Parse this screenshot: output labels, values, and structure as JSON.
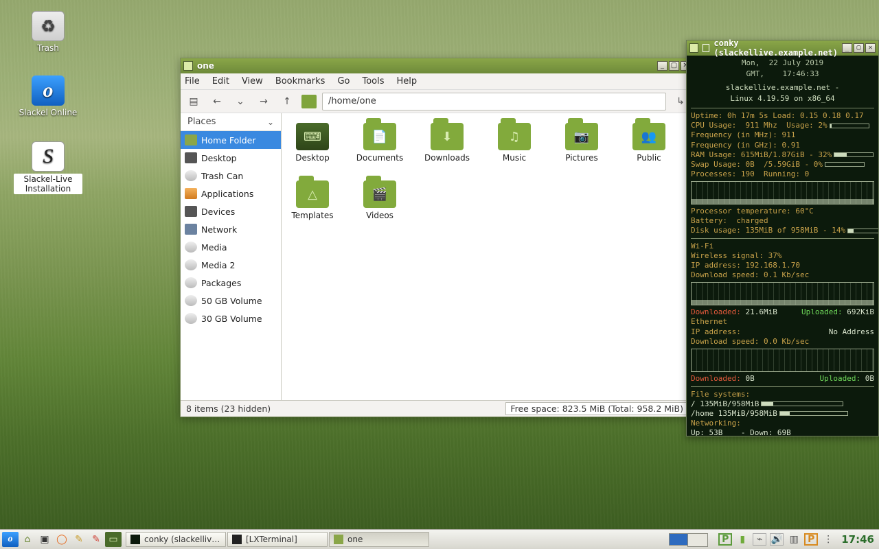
{
  "desktop_icons": {
    "trash": "Trash",
    "slackel_online": "Slackel Online",
    "slackel_install": "Slackel-Live Installation"
  },
  "fm": {
    "title": "one",
    "menu": {
      "file": "File",
      "edit": "Edit",
      "view": "View",
      "bookmarks": "Bookmarks",
      "go": "Go",
      "tools": "Tools",
      "help": "Help"
    },
    "path": "/home/one",
    "places_header": "Places",
    "places": {
      "home": "Home Folder",
      "desktop": "Desktop",
      "trash": "Trash Can",
      "apps": "Applications",
      "devices": "Devices",
      "network": "Network",
      "media": "Media",
      "media2": "Media 2",
      "packages": "Packages",
      "vol50": "50 GB Volume",
      "vol30": "30 GB Volume"
    },
    "folders": {
      "desktop": "Desktop",
      "documents": "Documents",
      "downloads": "Downloads",
      "music": "Music",
      "pictures": "Pictures",
      "public": "Public",
      "templates": "Templates",
      "videos": "Videos"
    },
    "status_left": "8 items (23 hidden)",
    "status_right": "Free space: 823.5 MiB (Total: 958.2 MiB)"
  },
  "conky": {
    "title": "conky (slackellive.example.net)",
    "date_line": "Mon,  22 July 2019",
    "time_line": "GMT,    17:46:33",
    "host_line": "slackellive.example.net -",
    "kernel_line": "Linux 4.19.59 on x86_64",
    "uptime": "Uptime: 0h 17m 5s Load: 0.15 0.18 0.17",
    "cpu": "CPU Usage:  911 Mhz  Usage: 2%",
    "freq_mhz": "Frequency (in MHz): 911",
    "freq_ghz": "Frequency (in GHz): 0.91",
    "ram": "RAM Usage: 615MiB/1.87GiB - 32%",
    "swap": "Swap Usage: 0B  /5.59GiB - 0%",
    "procs": "Processes: 190  Running: 0",
    "temp": "Processor temperature: 60°C",
    "batt": "Battery:  charged",
    "disk": "Disk usage: 135MiB of 958MiB - 14%",
    "wifi_hdr": "Wi-Fi",
    "wifi_sig": "Wireless signal: 37%",
    "wifi_ip": "IP address: 192.168.1.70",
    "wifi_dn": "Download speed: 0.1 Kb/sec",
    "wifi_dl_label": "Downloaded:",
    "wifi_dl_val": "21.6MiB",
    "wifi_ul_label": "Uploaded:",
    "wifi_ul_val": "692KiB",
    "eth_hdr": "Ethernet",
    "eth_ip_l": "IP address:",
    "eth_ip_v": "No Address",
    "eth_dn": "Download speed: 0.0 Kb/sec",
    "eth_dl_label": "Downloaded:",
    "eth_dl_val": "0B",
    "eth_ul_label": "Uploaded:",
    "eth_ul_val": "0B",
    "fs_hdr": "File systems:",
    "fs_root": "/ 135MiB/958MiB",
    "fs_home": "/home 135MiB/958MiB",
    "net_hdr": "Networking:",
    "net_updown": "Up: 53B    - Down: 69B"
  },
  "taskbar": {
    "task1": "conky (slackelliv…",
    "task2": "[LXTerminal]",
    "task3": "one",
    "clock": "17:46"
  }
}
